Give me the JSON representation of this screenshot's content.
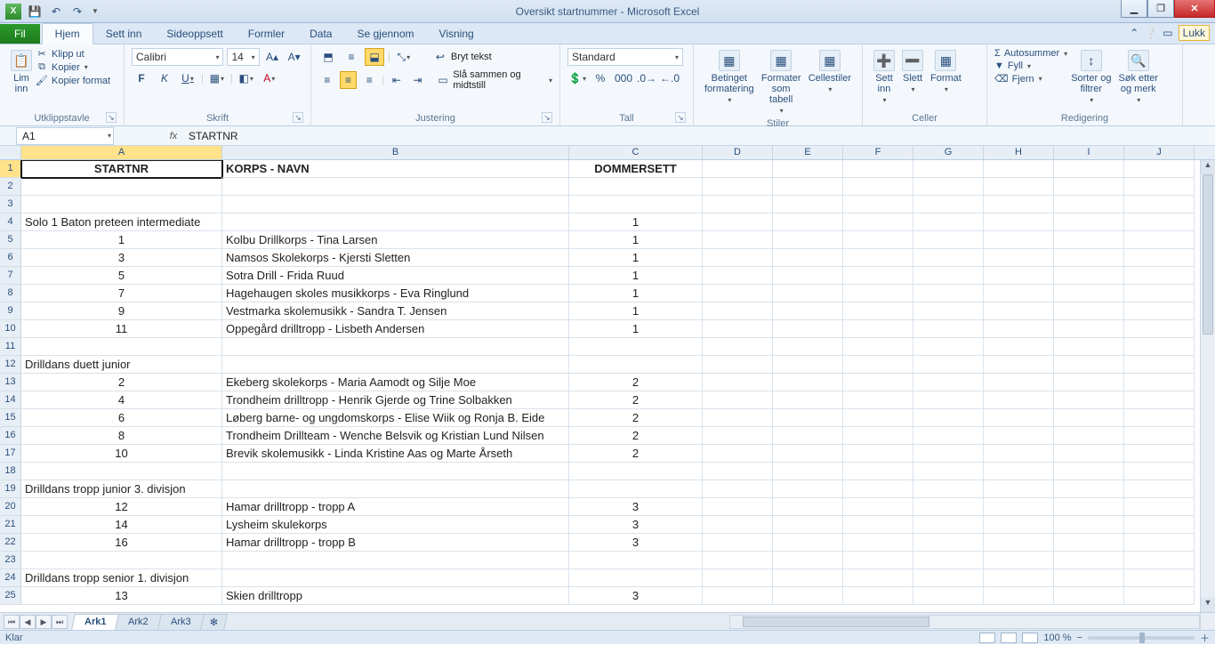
{
  "window_title": "Oversikt startnummer  -  Microsoft Excel",
  "qat": {
    "save": "💾",
    "undo": "↶",
    "redo": "↷"
  },
  "tabs": {
    "file": "Fil",
    "items": [
      "Hjem",
      "Sett inn",
      "Sideoppsett",
      "Formler",
      "Data",
      "Se gjennom",
      "Visning"
    ],
    "lukk": "Lukk"
  },
  "ribbon": {
    "clipboard": {
      "paste": "Lim\ninn",
      "cut": "Klipp ut",
      "copy": "Kopier",
      "format_painter": "Kopier format",
      "label": "Utklippstavle"
    },
    "font": {
      "name": "Calibri",
      "size": "14",
      "label": "Skrift"
    },
    "alignment": {
      "wrap": "Bryt tekst",
      "merge": "Slå sammen og midtstill",
      "label": "Justering"
    },
    "number": {
      "format": "Standard",
      "label": "Tall"
    },
    "styles": {
      "cond": "Betinget\nformatering",
      "table": "Formater\nsom tabell",
      "cell": "Cellestiler",
      "label": "Stiler"
    },
    "cells": {
      "insert": "Sett\ninn",
      "delete": "Slett",
      "format": "Format",
      "label": "Celler"
    },
    "editing": {
      "sum": "Autosummer",
      "fill": "Fyll",
      "clear": "Fjern",
      "sort": "Sorter og\nfiltrer",
      "find": "Søk etter\nog merk",
      "label": "Redigering"
    }
  },
  "name_box": "A1",
  "formula": "STARTNR",
  "columns": [
    "A",
    "B",
    "C",
    "D",
    "E",
    "F",
    "G",
    "H",
    "I",
    "J"
  ],
  "header_row": {
    "a": "STARTNR",
    "b": "KORPS - NAVN",
    "c": "DOMMERSETT"
  },
  "rows": [
    {
      "n": 2
    },
    {
      "n": 3
    },
    {
      "n": 4,
      "a": "Solo 1 Baton preteen intermediate",
      "c": "1",
      "cat": true
    },
    {
      "n": 5,
      "a": "1",
      "b": "Kolbu Drillkorps - Tina Larsen",
      "c": "1"
    },
    {
      "n": 6,
      "a": "3",
      "b": "Namsos Skolekorps - Kjersti Sletten",
      "c": "1"
    },
    {
      "n": 7,
      "a": "5",
      "b": "Sotra Drill - Frida Ruud",
      "c": "1"
    },
    {
      "n": 8,
      "a": "7",
      "b": "Hagehaugen skoles musikkorps - Eva Ringlund",
      "c": "1"
    },
    {
      "n": 9,
      "a": "9",
      "b": "Vestmarka skolemusikk - Sandra T. Jensen",
      "c": "1"
    },
    {
      "n": 10,
      "a": "11",
      "b": "Oppegård drilltropp - Lisbeth Andersen",
      "c": "1"
    },
    {
      "n": 11
    },
    {
      "n": 12,
      "a": "Drilldans duett junior",
      "cat": true
    },
    {
      "n": 13,
      "a": "2",
      "b": "Ekeberg skolekorps - Maria Aamodt og Silje Moe",
      "c": "2"
    },
    {
      "n": 14,
      "a": "4",
      "b": "Trondheim drilltropp - Henrik Gjerde og Trine Solbakken",
      "c": "2"
    },
    {
      "n": 15,
      "a": "6",
      "b": "Løberg barne- og ungdomskorps - Elise Wiik og Ronja B. Eide",
      "c": "2"
    },
    {
      "n": 16,
      "a": "8",
      "b": "Trondheim Drillteam - Wenche Belsvik og Kristian Lund Nilsen",
      "c": "2"
    },
    {
      "n": 17,
      "a": "10",
      "b": "Brevik skolemusikk - Linda Kristine Aas og Marte Årseth",
      "c": "2"
    },
    {
      "n": 18
    },
    {
      "n": 19,
      "a": "Drilldans tropp junior 3. divisjon",
      "cat": true
    },
    {
      "n": 20,
      "a": "12",
      "b": "Hamar drilltropp - tropp A",
      "c": "3"
    },
    {
      "n": 21,
      "a": "14",
      "b": "Lysheim skulekorps",
      "c": "3"
    },
    {
      "n": 22,
      "a": "16",
      "b": "Hamar drilltropp - tropp B",
      "c": "3"
    },
    {
      "n": 23
    },
    {
      "n": 24,
      "a": "Drilldans tropp senior 1. divisjon",
      "cat": true
    },
    {
      "n": 25,
      "a": "13",
      "b": "Skien drilltropp",
      "c": "3"
    }
  ],
  "sheets": [
    "Ark1",
    "Ark2",
    "Ark3"
  ],
  "status": {
    "ready": "Klar",
    "zoom": "100 %"
  }
}
